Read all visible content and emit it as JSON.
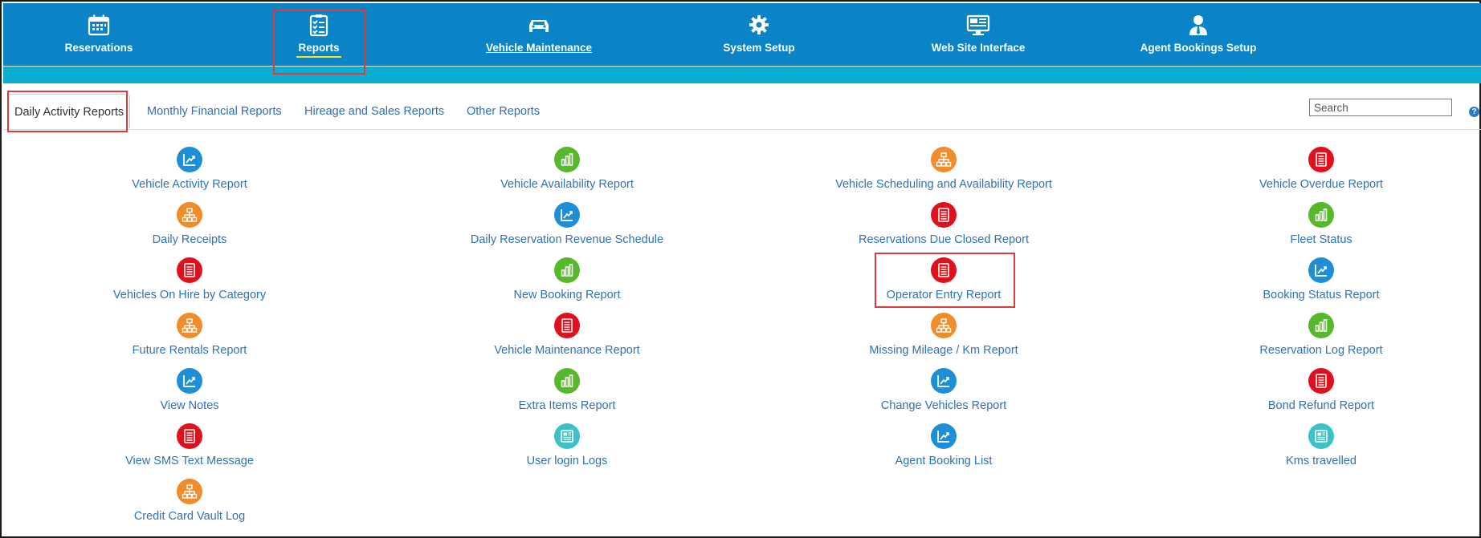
{
  "nav": {
    "items": [
      {
        "label": "Reservations",
        "icon": "calendar-icon",
        "active": false,
        "underline": false
      },
      {
        "label": "Reports",
        "icon": "checklist-icon",
        "active": true,
        "underline": false
      },
      {
        "label": "Vehicle Maintenance",
        "icon": "car-icon",
        "active": false,
        "underline": true
      },
      {
        "label": "System Setup",
        "icon": "gear-icon",
        "active": false,
        "underline": false
      },
      {
        "label": "Web Site Interface",
        "icon": "monitor-icon",
        "active": false,
        "underline": false
      },
      {
        "label": "Agent Bookings Setup",
        "icon": "agent-icon",
        "active": false,
        "underline": false
      }
    ]
  },
  "tabs": [
    {
      "label": "Daily Activity Reports",
      "active": true
    },
    {
      "label": "Monthly Financial Reports",
      "active": false
    },
    {
      "label": "Hireage and Sales Reports",
      "active": false
    },
    {
      "label": "Other Reports",
      "active": false
    }
  ],
  "search": {
    "placeholder": "Search",
    "value": ""
  },
  "help": {
    "label": "?"
  },
  "colors": {
    "nav_bg": "#0a84c6",
    "nav_strip": "#0aaed3",
    "link": "#2f72b5",
    "highlight": "#e03a3a",
    "blue": "#1e8fd6",
    "green": "#58b82c",
    "orange": "#f18c2a",
    "red": "#e0111d",
    "teal": "#3cc1c6"
  },
  "reports": {
    "columns": [
      [
        {
          "label": "Vehicle Activity Report",
          "icon": "trend-chart-icon",
          "color": "blue"
        },
        {
          "label": "Daily Receipts",
          "icon": "hierarchy-icon",
          "color": "orange"
        },
        {
          "label": "Vehicles On Hire by Category",
          "icon": "document-icon",
          "color": "red"
        },
        {
          "label": "Future Rentals Report",
          "icon": "hierarchy-icon",
          "color": "orange"
        },
        {
          "label": "View Notes",
          "icon": "trend-chart-icon",
          "color": "blue"
        },
        {
          "label": "View SMS Text Message",
          "icon": "document-icon",
          "color": "red"
        },
        {
          "label": "Credit Card Vault Log",
          "icon": "hierarchy-icon",
          "color": "orange"
        }
      ],
      [
        {
          "label": "Vehicle Availability Report",
          "icon": "bar-chart-icon",
          "color": "green"
        },
        {
          "label": "Daily Reservation Revenue Schedule",
          "icon": "trend-chart-icon",
          "color": "blue"
        },
        {
          "label": "New Booking Report",
          "icon": "bar-chart-icon",
          "color": "green"
        },
        {
          "label": "Vehicle Maintenance Report",
          "icon": "document-icon",
          "color": "red"
        },
        {
          "label": "Extra Items Report",
          "icon": "bar-chart-icon",
          "color": "green"
        },
        {
          "label": "User login Logs",
          "icon": "newspaper-icon",
          "color": "teal"
        }
      ],
      [
        {
          "label": "Vehicle Scheduling and Availability Report",
          "icon": "hierarchy-icon",
          "color": "orange"
        },
        {
          "label": "Reservations Due Closed Report",
          "icon": "document-icon",
          "color": "red"
        },
        {
          "label": "Operator Entry Report",
          "icon": "document-icon",
          "color": "red",
          "highlighted": true
        },
        {
          "label": "Missing Mileage / Km Report",
          "icon": "hierarchy-icon",
          "color": "orange"
        },
        {
          "label": "Change Vehicles Report",
          "icon": "trend-chart-icon",
          "color": "blue"
        },
        {
          "label": "Agent Booking List",
          "icon": "trend-chart-icon",
          "color": "blue"
        }
      ],
      [
        {
          "label": "Vehicle Overdue Report",
          "icon": "document-icon",
          "color": "red"
        },
        {
          "label": "Fleet Status",
          "icon": "bar-chart-icon",
          "color": "green"
        },
        {
          "label": "Booking Status Report",
          "icon": "trend-chart-icon",
          "color": "blue"
        },
        {
          "label": "Reservation Log Report",
          "icon": "bar-chart-icon",
          "color": "green"
        },
        {
          "label": "Bond Refund Report",
          "icon": "document-icon",
          "color": "red"
        },
        {
          "label": "Kms travelled",
          "icon": "newspaper-icon",
          "color": "teal"
        }
      ]
    ]
  }
}
